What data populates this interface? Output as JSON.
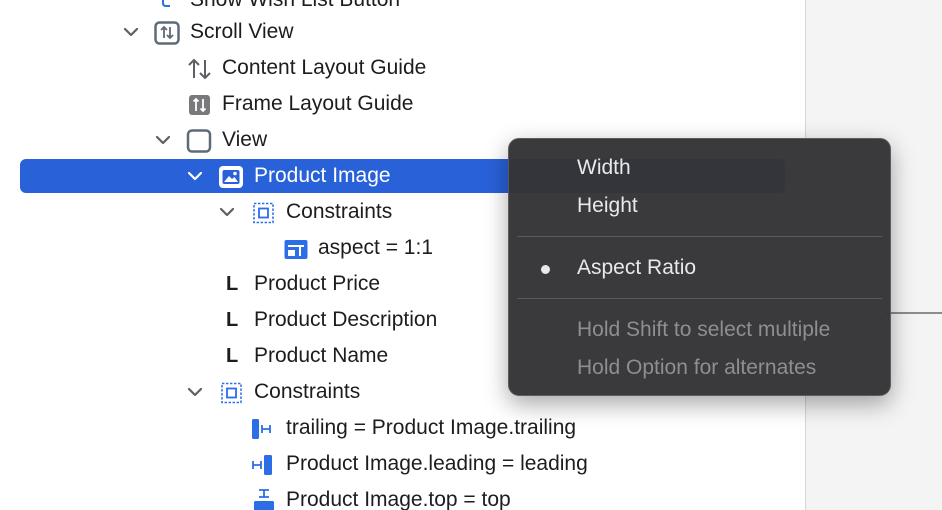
{
  "outline": {
    "partial_top": "Show Wish List Button",
    "rows": [
      {
        "label": "Scroll View",
        "icon": "scroll-view-icon"
      },
      {
        "label": "Content Layout Guide",
        "icon": "content-layout-guide-icon"
      },
      {
        "label": "Frame Layout Guide",
        "icon": "frame-layout-guide-icon"
      },
      {
        "label": "View",
        "icon": "view-icon"
      },
      {
        "label": "Product Image",
        "icon": "image-view-icon",
        "selected": true
      },
      {
        "label": "Constraints",
        "icon": "constraints-icon"
      },
      {
        "label": "aspect = 1:1",
        "icon": "aspect-constraint-icon"
      },
      {
        "label": "Product Price",
        "icon": "label-icon",
        "glyph": "L"
      },
      {
        "label": "Product Description",
        "icon": "label-icon",
        "glyph": "L"
      },
      {
        "label": "Product Name",
        "icon": "label-icon",
        "glyph": "L"
      },
      {
        "label": "Constraints",
        "icon": "constraints-icon"
      },
      {
        "label": "trailing = Product Image.trailing",
        "icon": "trailing-constraint-icon"
      },
      {
        "label": "Product Image.leading = leading",
        "icon": "leading-constraint-icon"
      },
      {
        "label": "Product Image.top = top",
        "icon": "top-constraint-icon"
      }
    ]
  },
  "menu": {
    "items": [
      "Width",
      "Height"
    ],
    "checked_item": "Aspect Ratio",
    "hints": [
      "Hold Shift to select multiple",
      "Hold Option for alternates"
    ]
  },
  "colors": {
    "selection": "#2961d9",
    "menu_bg": "#343436",
    "constraint_blue": "#2b6ee6"
  }
}
